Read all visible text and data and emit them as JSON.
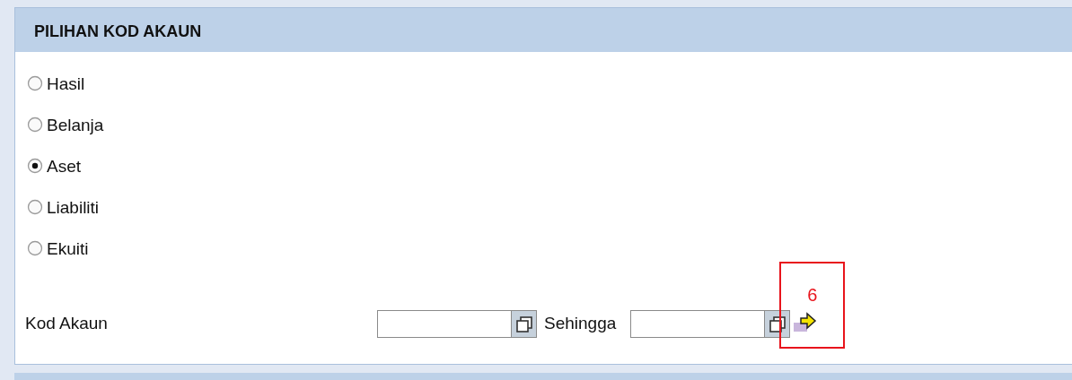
{
  "panel": {
    "title": "PILIHAN KOD AKAUN"
  },
  "options": [
    {
      "label": "Hasil",
      "selected": false
    },
    {
      "label": "Belanja",
      "selected": false
    },
    {
      "label": "Aset",
      "selected": true
    },
    {
      "label": "Liabiliti",
      "selected": false
    },
    {
      "label": "Ekuiti",
      "selected": false
    }
  ],
  "range": {
    "label": "Kod Akaun",
    "separator": "Sehingga"
  },
  "annotation": {
    "label": "6"
  }
}
